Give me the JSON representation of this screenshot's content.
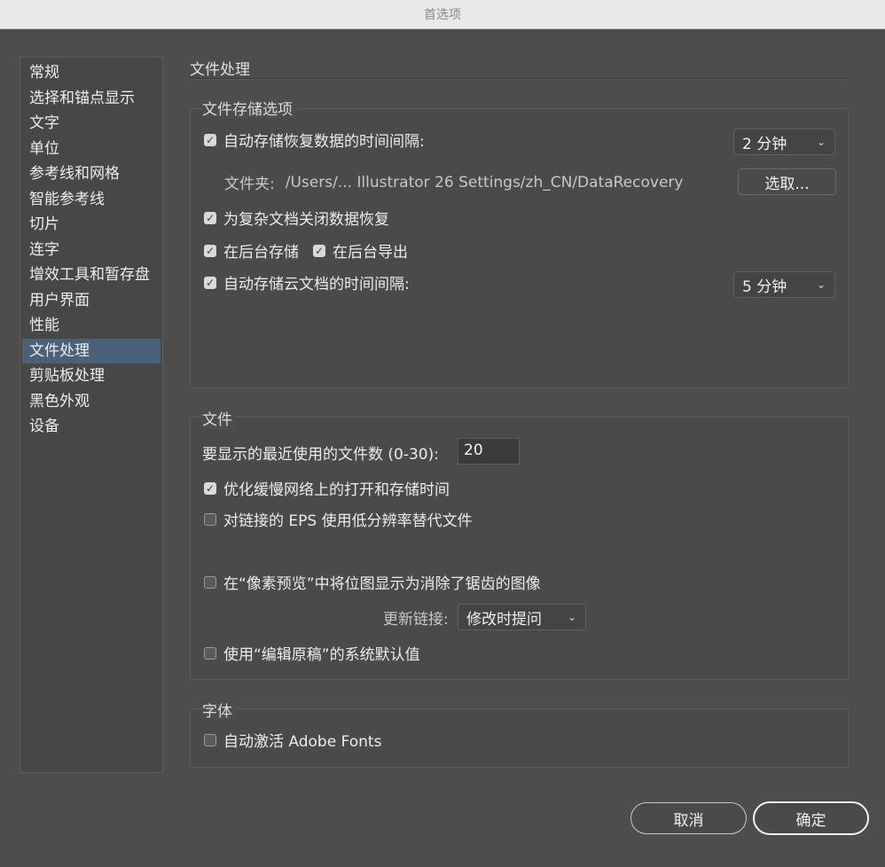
{
  "window": {
    "title": "首选项"
  },
  "sidebar": {
    "items": [
      {
        "label": "常规"
      },
      {
        "label": "选择和锚点显示"
      },
      {
        "label": "文字"
      },
      {
        "label": "单位"
      },
      {
        "label": "参考线和网格"
      },
      {
        "label": "智能参考线"
      },
      {
        "label": "切片"
      },
      {
        "label": "连字"
      },
      {
        "label": "增效工具和暂存盘"
      },
      {
        "label": "用户界面"
      },
      {
        "label": "性能"
      },
      {
        "label": "文件处理"
      },
      {
        "label": "剪贴板处理"
      },
      {
        "label": "黑色外观"
      },
      {
        "label": "设备"
      }
    ],
    "selected_index": 11
  },
  "main": {
    "heading": "文件处理",
    "save_group": {
      "title": "文件存储选项",
      "autosave_recovery_label": "自动存储恢复数据的时间间隔:",
      "autosave_recovery_checked": true,
      "autosave_recovery_interval": "2 分钟",
      "folder_label": "文件夹:",
      "folder_path": "/Users/... Illustrator 26 Settings/zh_CN/DataRecovery",
      "choose_button": "选取...",
      "disable_complex_label": "为复杂文档关闭数据恢复",
      "disable_complex_checked": true,
      "bg_save_label": "在后台存储",
      "bg_save_checked": true,
      "bg_export_label": "在后台导出",
      "bg_export_checked": true,
      "autosave_cloud_label": "自动存储云文档的时间间隔:",
      "autosave_cloud_checked": true,
      "autosave_cloud_interval": "5 分钟"
    },
    "file_group": {
      "title": "文件",
      "recent_files_label": "要显示的最近使用的文件数 (0-30):",
      "recent_files_value": "20",
      "optimize_network_label": "优化缓慢网络上的打开和存储时间",
      "optimize_network_checked": true,
      "low_res_eps_label": "对链接的 EPS 使用低分辨率替代文件",
      "low_res_eps_checked": false,
      "antialias_label": "在“像素预览”中将位图显示为消除了锯齿的图像",
      "antialias_checked": false,
      "update_links_label": "更新链接:",
      "update_links_value": "修改时提问",
      "edit_original_label": "使用“编辑原稿”的系统默认值",
      "edit_original_checked": false
    },
    "fonts_group": {
      "title": "字体",
      "auto_activate_label": "自动激活 Adobe Fonts",
      "auto_activate_checked": false
    }
  },
  "footer": {
    "cancel_label": "取消",
    "ok_label": "确定"
  }
}
